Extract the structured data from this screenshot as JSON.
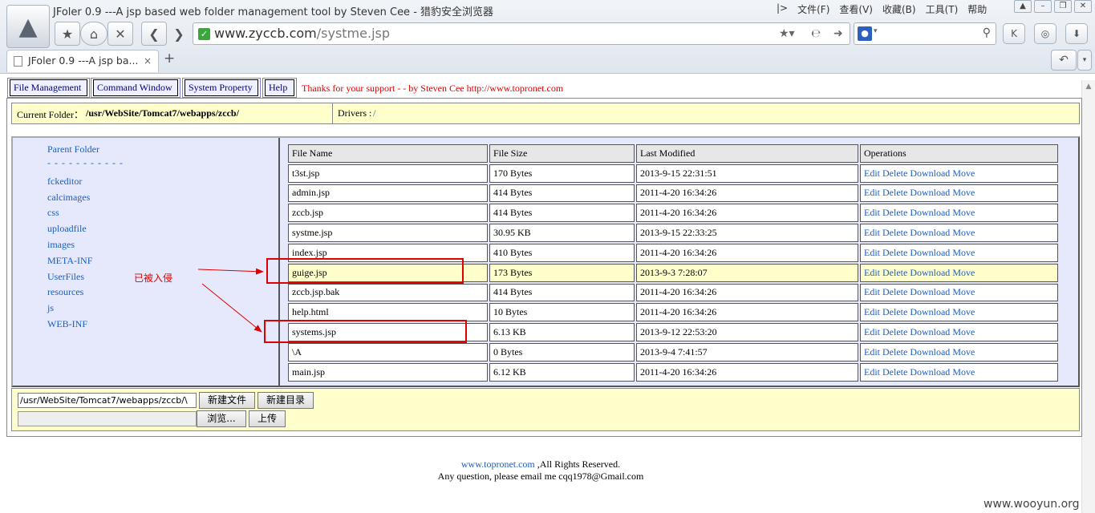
{
  "browser": {
    "window_title": "JFoler 0.9 ---A jsp based web folder management tool by Steven Cee - 猎豹安全浏览器",
    "menu": [
      "文件(F)",
      "查看(V)",
      "收藏(B)",
      "工具(T)",
      "帮助"
    ],
    "url_host": "www.zyccb.com",
    "url_path": "/systme.jsp",
    "tab_title": "JFoler 0.9 ---A jsp ba...",
    "tab_close": "×",
    "new_tab": "+"
  },
  "toolbar": {
    "buttons": [
      "File Management",
      "Command Window",
      "System Property",
      "Help"
    ],
    "thanks": "Thanks for your support - - by Steven Cee http://www.topronet.com"
  },
  "folder": {
    "current_label": "Current Folder：",
    "current_path": "/usr/WebSite/Tomcat7/webapps/zccb/",
    "drivers_label": "Drivers :",
    "drivers_link": "/"
  },
  "dirs": {
    "parent": "Parent Folder",
    "separator": "- - - - - - - - - - -",
    "items": [
      "fckeditor",
      "calcimages",
      "css",
      "uploadfile",
      "images",
      "META-INF",
      "UserFiles",
      "resources",
      "js",
      "WEB-INF"
    ]
  },
  "annotation": "已被入侵",
  "table": {
    "headers": [
      "File Name",
      "File Size",
      "Last Modified",
      "Operations"
    ],
    "ops": [
      "Edit",
      "Delete",
      "Download",
      "Move"
    ],
    "rows": [
      {
        "name": "t3st.jsp",
        "size": "170 Bytes",
        "modified": "2013-9-15 22:31:51"
      },
      {
        "name": "admin.jsp",
        "size": "414 Bytes",
        "modified": "2011-4-20 16:34:26"
      },
      {
        "name": "zccb.jsp",
        "size": "414 Bytes",
        "modified": "2011-4-20 16:34:26"
      },
      {
        "name": "systme.jsp",
        "size": "30.95 KB",
        "modified": "2013-9-15 22:33:25"
      },
      {
        "name": "index.jsp",
        "size": "410 Bytes",
        "modified": "2011-4-20 16:34:26"
      },
      {
        "name": "guige.jsp",
        "size": "173 Bytes",
        "modified": "2013-9-3 7:28:07"
      },
      {
        "name": "zccb.jsp.bak",
        "size": "414 Bytes",
        "modified": "2011-4-20 16:34:26"
      },
      {
        "name": "help.html",
        "size": "10 Bytes",
        "modified": "2011-4-20 16:34:26"
      },
      {
        "name": "systems.jsp",
        "size": "6.13 KB",
        "modified": "2013-9-12 22:53:20"
      },
      {
        "name": "\\A",
        "size": "0 Bytes",
        "modified": "2013-9-4 7:41:57"
      },
      {
        "name": "main.jsp",
        "size": "6.12 KB",
        "modified": "2011-4-20 16:34:26"
      }
    ]
  },
  "upload": {
    "path_value": "/usr/WebSite/Tomcat7/webapps/zccb/\\",
    "new_file": "新建文件",
    "new_dir": "新建目录",
    "browse": "浏览...",
    "upload": "上传"
  },
  "footer": {
    "link": "www.topronet.com",
    "rights": " ,All Rights Reserved.",
    "contact": "Any question, please email me cqq1978@Gmail.com"
  },
  "watermark": "www.wooyun.org"
}
